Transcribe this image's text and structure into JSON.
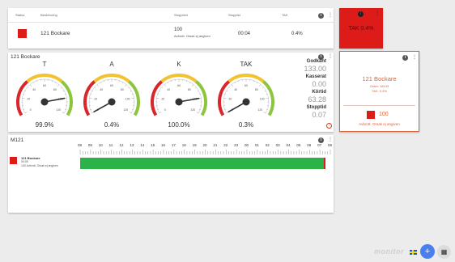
{
  "table": {
    "headers": [
      "Status",
      "Beskrivning",
      "Stopptext",
      "Stopptid",
      "TAK"
    ],
    "row": {
      "status_color": "#dd1c1a",
      "description": "121 Bockare",
      "stop_code": "100",
      "stop_text": "Avbrott. Orsak ej angiven",
      "stop_time": "00:04",
      "tak": "0.4%"
    }
  },
  "tak_tile": {
    "label": "TAK 0.4%",
    "color": "#dd1c1a"
  },
  "gauges_panel": {
    "title": "121 Bockare",
    "gauges": [
      {
        "label": "T",
        "value_text": "99.9%",
        "value": 99.9
      },
      {
        "label": "A",
        "value_text": "0.4%",
        "value": 0.4
      },
      {
        "label": "K",
        "value_text": "100.0%",
        "value": 100.0
      },
      {
        "label": "TAK",
        "value_text": "0.3%",
        "value": 0.3
      }
    ],
    "tick_labels": [
      "0",
      "20",
      "40",
      "60",
      "80",
      "100",
      "120"
    ],
    "stats": [
      {
        "label": "Godkänt",
        "value": "133.00"
      },
      {
        "label": "Kasserat",
        "value": "0.00"
      },
      {
        "label": "Körtid",
        "value": "63.28"
      },
      {
        "label": "Stopptid",
        "value": "0.07"
      }
    ]
  },
  "machine_card": {
    "title": "121 Bockare",
    "line1": "Order: 18133",
    "line2": "TAK: 0.4%",
    "stop_code": "100",
    "stop_text": "Avbrott. Orsak ej angiven",
    "accent": "#d9623a",
    "status_color": "#dd1c1a"
  },
  "timeline": {
    "title": "M121",
    "machine_name": "121 Bockare",
    "machine_time": "00:05",
    "machine_stop": "100 Avbrott. Orsak ej angiven",
    "hours": [
      "08",
      "09",
      "10",
      "11",
      "12",
      "13",
      "14",
      "15",
      "16",
      "17",
      "18",
      "19",
      "20",
      "21",
      "22",
      "23",
      "00",
      "01",
      "02",
      "03",
      "04",
      "05",
      "06",
      "07",
      "08"
    ],
    "bar_color": "#2bb34a"
  },
  "footer": {
    "brand": "monitor",
    "flag": "SE",
    "fab_icon": "+",
    "grid_icon": "▦"
  }
}
